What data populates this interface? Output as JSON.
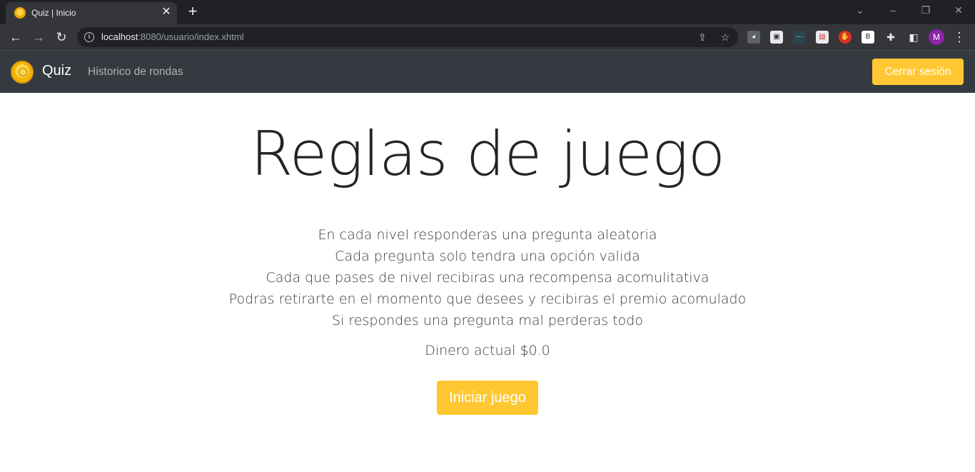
{
  "browser": {
    "tab_title": "Quiz | Inicio",
    "url_host": "localhost",
    "url_path": ":8080/usuario/index.xhtml",
    "profile_initial": "M",
    "extensions": [
      "cat-extension-icon",
      "bookmark-extension-icon",
      "dots-extension-icon",
      "cast-extension-icon",
      "adblock-extension-icon",
      "b-extension-icon",
      "puzzle-icon",
      "sidepanel-icon"
    ],
    "ext_b_label": "B"
  },
  "navbar": {
    "brand": "Quiz",
    "history_link": "Historico de rondas",
    "logout_label": "Cerrar sesión"
  },
  "main": {
    "title": "Reglas de juego",
    "rules": [
      "En cada nivel responderas una pregunta aleatoria",
      "Cada pregunta solo tendra una opción valida",
      "Cada que pases de nivel recibiras una recompensa acomulitativa",
      "Podras retirarte en el momento que desees y recibiras el premio acomulado",
      "Si respondes una pregunta mal perderas todo"
    ],
    "money_text": "Dinero actual $0.0",
    "start_label": "Iniciar juego"
  },
  "colors": {
    "accent": "#ffc832",
    "navbar_bg": "#343a40"
  }
}
